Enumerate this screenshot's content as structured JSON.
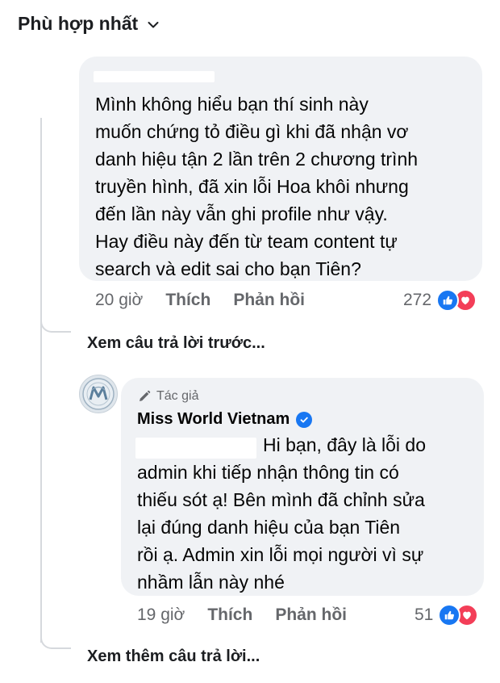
{
  "sort": {
    "label": "Phù hợp nhất"
  },
  "comment1": {
    "text_lines": [
      "Mình không hiểu bạn thí sinh này",
      "muốn chứng tỏ điều gì khi đã nhận vơ",
      "danh hiệu tận 2 lần trên 2 chương trình",
      "truyền hình, đã xin lỗi Hoa khôi nhưng",
      "đến lần này vẫn ghi profile như vậy.",
      "Hay điều này đến từ team content tự",
      "search và edit sai cho bạn Tiên?"
    ],
    "time": "20 giờ",
    "like_label": "Thích",
    "reply_label": "Phản hồi",
    "reaction_count": "272"
  },
  "view_previous": {
    "label": "Xem câu trả lời trước..."
  },
  "reply1": {
    "badge_label": "Tác giả",
    "author_name": "Miss World Vietnam",
    "first_line": "Hi bạn, đây là lỗi do",
    "text_lines": [
      "admin khi tiếp nhận thông tin có",
      "thiếu sót ạ! Bên mình đã chỉnh sửa",
      "lại đúng danh hiệu của bạn Tiên",
      "rồi ạ. Admin xin lỗi mọi người vì sự",
      "nhầm lẫn này nhé"
    ],
    "time": "19 giờ",
    "like_label": "Thích",
    "reply_label": "Phản hồi",
    "reaction_count": "51"
  },
  "view_more": {
    "label": "Xem thêm câu trả lời..."
  },
  "colors": {
    "bubble_bg": "#f0f2f5",
    "meta_text": "#65676b",
    "like_blue": "#1877f2",
    "love_red": "#f33e58",
    "thread_line": "#d6d9dd"
  },
  "icons": {
    "sort": "chevron-down-icon",
    "like": "like-reaction-icon",
    "love": "love-reaction-icon",
    "author": "pencil-icon",
    "verified": "verified-badge-icon"
  }
}
